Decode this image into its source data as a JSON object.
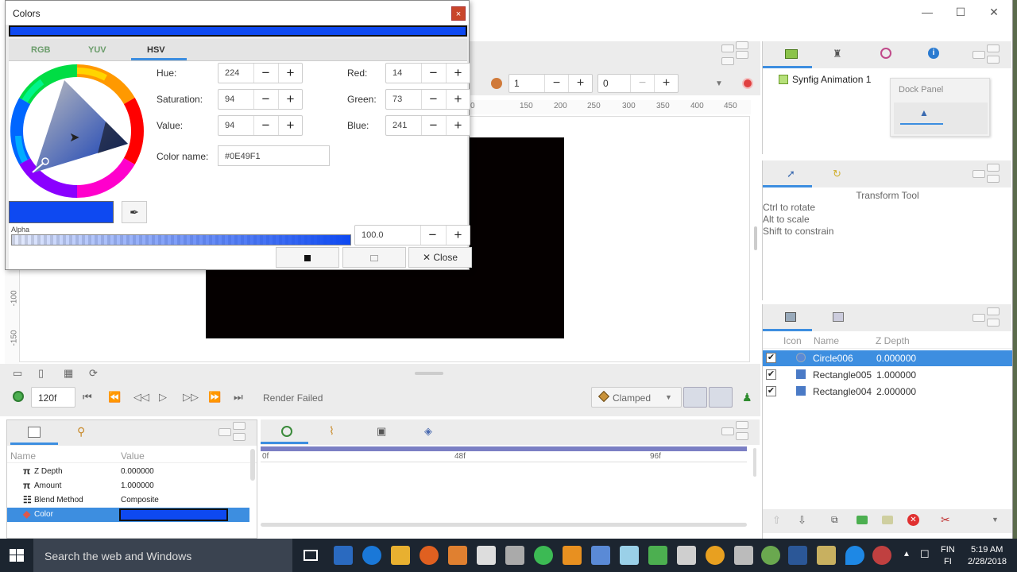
{
  "dialog": {
    "title": "Colors",
    "close_x": "×",
    "tabs": [
      "RGB",
      "YUV",
      "HSV"
    ],
    "active_tab": "HSV",
    "current_color": "#0e49f1",
    "hsv": [
      {
        "label": "Hue:",
        "value": "224"
      },
      {
        "label": "Saturation:",
        "value": "94"
      },
      {
        "label": "Value:",
        "value": "94"
      }
    ],
    "rgb": [
      {
        "label": "Red:",
        "value": "14"
      },
      {
        "label": "Green:",
        "value": "73"
      },
      {
        "label": "Blue:",
        "value": "241"
      }
    ],
    "color_name_label": "Color name:",
    "color_name": "#0E49F1",
    "alpha_label": "Alpha",
    "alpha_value": "100.0",
    "close_label": "Close",
    "minus": "−",
    "plus": "+"
  },
  "canvas": {
    "toolbar": {
      "frame_a": "1",
      "frame_b": "0"
    },
    "ruler_top": [
      "150",
      "200",
      "250",
      "300",
      "350",
      "400",
      "450"
    ],
    "ruler_left": [
      "-100",
      "-150"
    ]
  },
  "timebar": {
    "end_time": "120f",
    "status": "Render Failed",
    "interpolation": "Clamped"
  },
  "params": {
    "col_name": "Name",
    "col_value": "Value",
    "rows": [
      {
        "icon": "π",
        "name": "Z Depth",
        "value": "0.000000"
      },
      {
        "icon": "π",
        "name": "Amount",
        "value": "1.000000"
      },
      {
        "icon": "☷",
        "name": "Blend Method",
        "value": "Composite"
      },
      {
        "icon": "◆",
        "name": "Color",
        "value": ""
      }
    ]
  },
  "timetrack": {
    "marks": [
      "0f",
      "48f",
      "96f"
    ]
  },
  "canvas_browser": {
    "item": "Synfig Animation 1",
    "dock_panel": "Dock Panel"
  },
  "tool_options": {
    "title": "Transform Tool",
    "hints": [
      "Ctrl to rotate",
      "Alt to scale",
      "Shift to constrain"
    ]
  },
  "layers": {
    "col_icon": "Icon",
    "col_name": "Name",
    "col_zdepth": "Z Depth",
    "rows": [
      {
        "name": "Circle006",
        "z": "0.000000",
        "selected": true
      },
      {
        "name": "Rectangle005",
        "z": "1.000000",
        "selected": false
      },
      {
        "name": "Rectangle004",
        "z": "2.000000",
        "selected": false
      }
    ]
  },
  "taskbar": {
    "search_placeholder": "Search the web and Windows",
    "lang_top": "FIN",
    "lang_bottom": "FI",
    "time": "5:19 AM",
    "date": "2/28/2018"
  },
  "window": {
    "minimize": "—",
    "maximize": "☐",
    "close": "✕"
  }
}
